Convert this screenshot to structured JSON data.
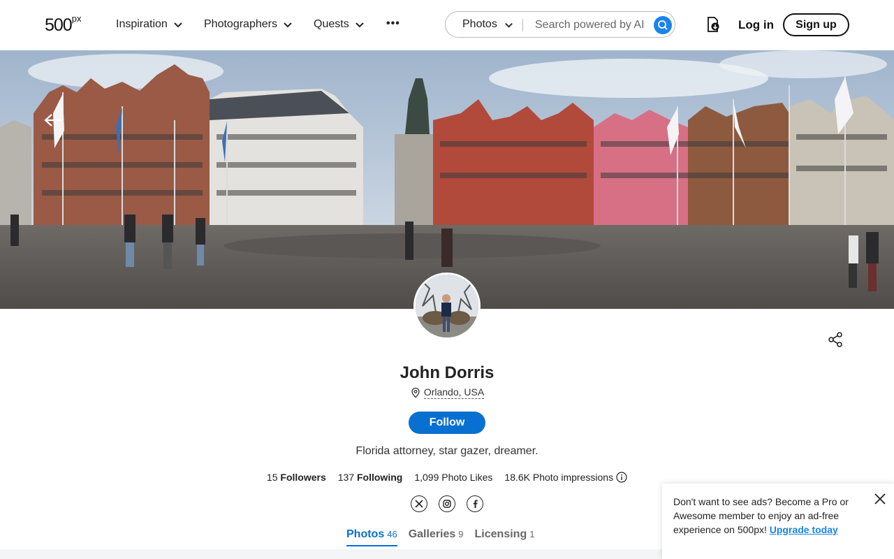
{
  "header": {
    "logo": "500",
    "logo_suffix": "px",
    "nav": [
      {
        "label": "Inspiration"
      },
      {
        "label": "Photographers"
      },
      {
        "label": "Quests"
      }
    ],
    "more_label": "•••",
    "search": {
      "type_label": "Photos",
      "placeholder": "Search powered by AI"
    },
    "login_label": "Log in",
    "signup_label": "Sign up"
  },
  "profile": {
    "name": "John Dorris",
    "location": "Orlando, USA",
    "follow_label": "Follow",
    "bio": "Florida attorney, star gazer, dreamer.",
    "stats": {
      "followers_count": "15",
      "followers_label": "Followers",
      "following_count": "137",
      "following_label": "Following",
      "photo_likes": "1,099 Photo Likes",
      "impressions": "18.6K Photo impressions"
    },
    "socials": [
      "x-icon",
      "instagram-icon",
      "facebook-icon"
    ]
  },
  "tabs": [
    {
      "label": "Photos",
      "count": "46",
      "active": true
    },
    {
      "label": "Galleries",
      "count": "9"
    },
    {
      "label": "Licensing",
      "count": "1"
    }
  ],
  "ad": {
    "text": "Don't want to see ads? Become a Pro or Awesome member to enjoy an ad-free experience on 500px! ",
    "link_label": "Upgrade today"
  },
  "colors": {
    "accent": "#0870d1",
    "search_button": "#1a84e8"
  }
}
